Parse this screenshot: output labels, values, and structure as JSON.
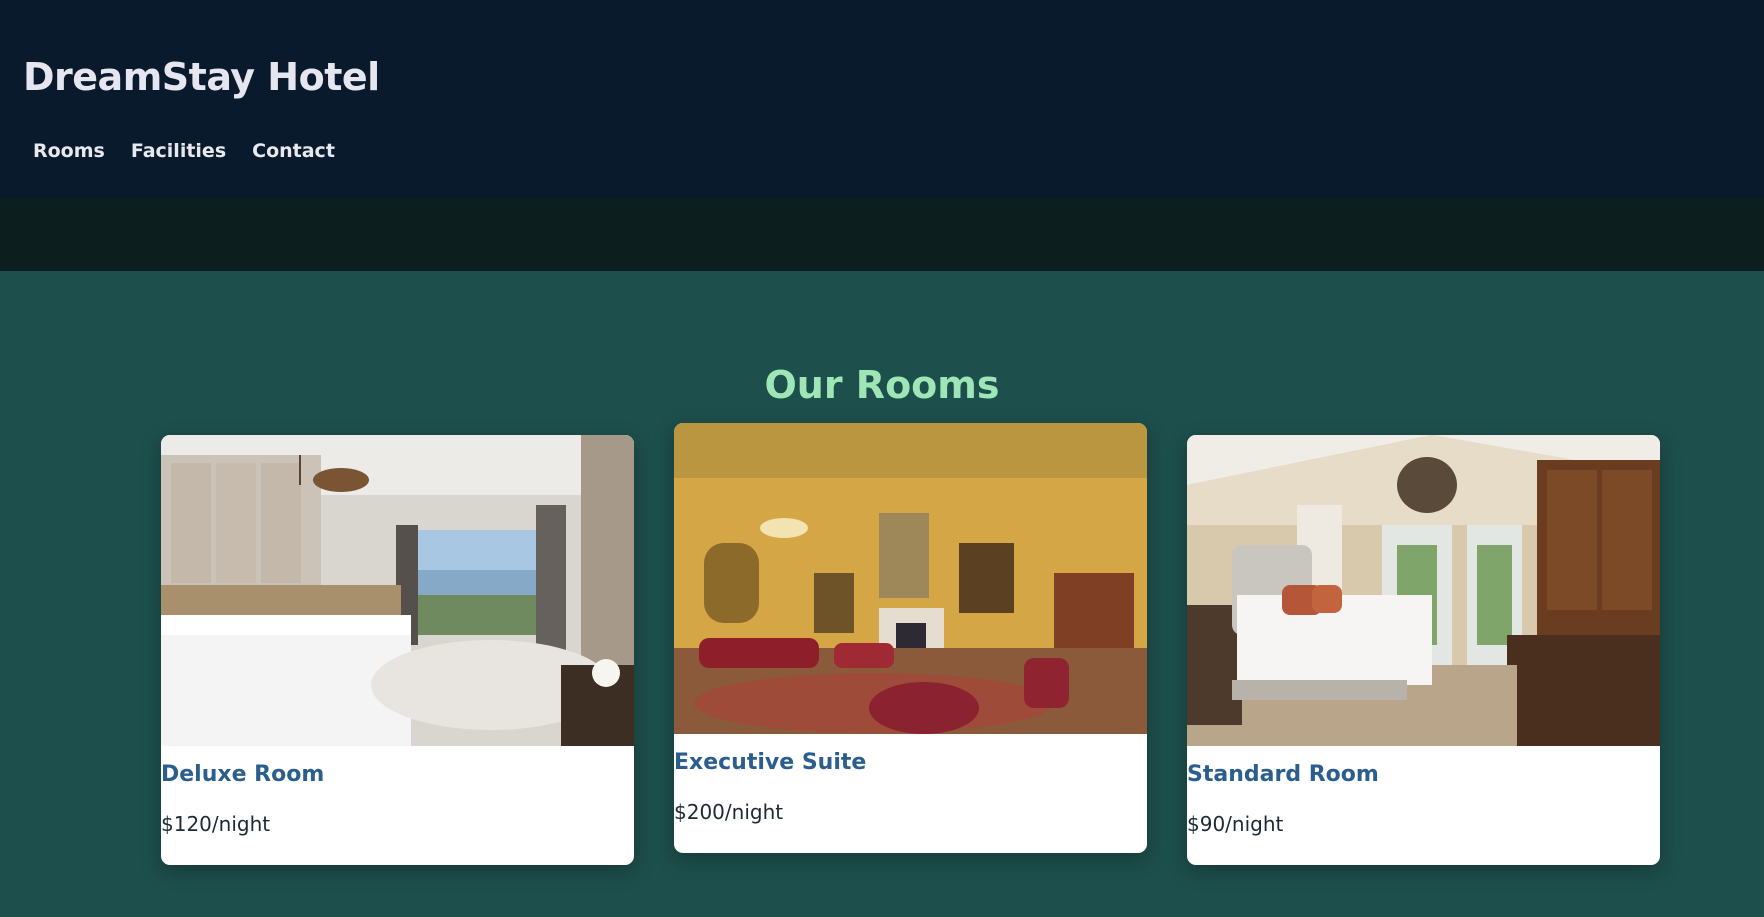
{
  "site": {
    "brand": "DreamStay Hotel"
  },
  "nav": {
    "items": [
      {
        "label": "Rooms"
      },
      {
        "label": "Facilities"
      },
      {
        "label": "Contact"
      }
    ]
  },
  "rooms_section": {
    "title": "Our Rooms",
    "rooms": [
      {
        "name": "Deluxe Room",
        "price": "$120/night",
        "photo": "modern-hotel-room-photo"
      },
      {
        "name": "Executive Suite",
        "price": "$200/night",
        "photo": "ornate-golden-suite-photo"
      },
      {
        "name": "Standard Room",
        "price": "$90/night",
        "photo": "vaulted-bedroom-photo"
      }
    ]
  },
  "colors": {
    "header_bg": "#0a1a2d",
    "band_bg": "#0d1e1e",
    "section_bg": "#1d4f4c",
    "section_title": "#9fe6b6",
    "room_name": "#2b5e8c"
  }
}
